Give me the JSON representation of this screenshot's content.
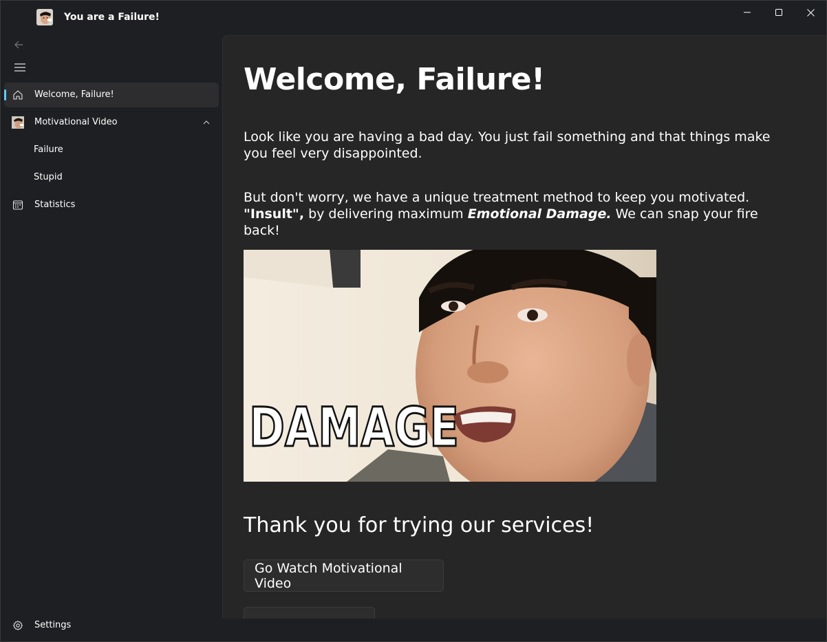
{
  "window": {
    "title": "You are a Failure!",
    "caption_buttons": [
      "minimize-icon",
      "maximize-icon",
      "close-icon"
    ]
  },
  "sidebar": {
    "back_icon": "back-arrow-icon",
    "menu_icon": "hamburger-icon",
    "items": [
      {
        "label": "Welcome, Failure!",
        "icon": "home-icon",
        "selected": true
      },
      {
        "label": "Motivational Video",
        "icon": "avatar-icon",
        "expanded": true,
        "children": [
          {
            "label": "Failure"
          },
          {
            "label": "Stupid"
          }
        ]
      },
      {
        "label": "Statistics",
        "icon": "calendar-icon"
      }
    ],
    "footer": {
      "label": "Settings",
      "icon": "gear-icon"
    }
  },
  "main": {
    "heading": "Welcome, Failure!",
    "para1": "Look like you are having a bad day. You just fail something and that things make you feel very disappointed.",
    "para2": {
      "prefix": "But don't worry, we have a unique treatment method to keep you motivated. ",
      "bold": "\"Insult\",",
      "mid": " by delivering maximum ",
      "bold_italic": "Emotional Damage.",
      "suffix": " We can snap your fire back!"
    },
    "image_caption_text": "DAMAGE",
    "subheading": "Thank you for trying our services!",
    "buttons": [
      {
        "label": "Go Watch Motivational Video"
      },
      {
        "label": ""
      }
    ]
  },
  "colors": {
    "accent": "#60cdff",
    "background": "#1e1f22",
    "content_bg": "#262626"
  }
}
